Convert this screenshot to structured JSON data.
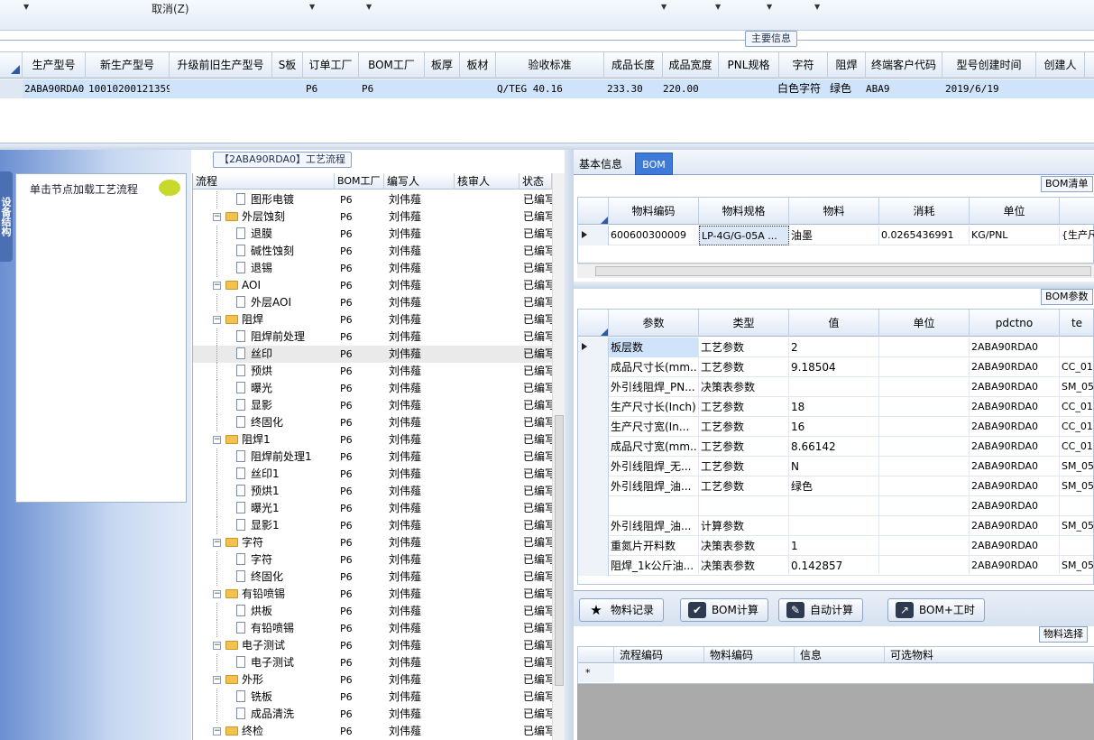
{
  "toolbar": {
    "cancel_label": "取消(Z)"
  },
  "main_info": {
    "section_label": "主要信息",
    "headers": [
      "生产型号",
      "新生产型号",
      "升级前旧生产型号",
      "S板",
      "订单工厂",
      "BOM工厂",
      "板厚",
      "板材",
      "验收标准",
      "成品长度",
      "成品宽度",
      "PNL规格",
      "字符",
      "阻焊",
      "终端客户代码",
      "型号创建时间",
      "创建人"
    ],
    "row": {
      "c0": "2ABA90RDA0",
      "c1": "10010200121359",
      "c2": "",
      "c3": "",
      "c4": "P6",
      "c5": "P6",
      "c6": "",
      "c7": "",
      "c8": "Q/TEG 40.16",
      "c9": "233.30",
      "c10": "220.00",
      "c11": "",
      "c12": "白色字符",
      "c13": "绿色",
      "c14": "ABA9",
      "c15": "2019/6/19",
      "c16": ""
    }
  },
  "left_panel": {
    "tab_label": "设备结构",
    "hint": "单击节点加载工艺流程"
  },
  "process_tree": {
    "title": "【2ABA90RDA0】工艺流程",
    "headers": {
      "flow": "流程",
      "bom": "BOM工厂",
      "author": "编写人",
      "reviewer": "核审人",
      "status": "状态"
    },
    "rows": [
      {
        "name": "图形电镀",
        "bom": "P6",
        "author": "刘伟薤",
        "status": "已编写"
      },
      {
        "name": "外层蚀刻",
        "bom": "P6",
        "author": "刘伟薤",
        "status": "已编写"
      },
      {
        "name": "退膜",
        "bom": "P6",
        "author": "刘伟薤",
        "status": "已编写"
      },
      {
        "name": "碱性蚀刻",
        "bom": "P6",
        "author": "刘伟薤",
        "status": "已编写"
      },
      {
        "name": "退锡",
        "bom": "P6",
        "author": "刘伟薤",
        "status": "已编写"
      },
      {
        "name": "AOI",
        "bom": "P6",
        "author": "刘伟薤",
        "status": "已编写"
      },
      {
        "name": "外层AOI",
        "bom": "P6",
        "author": "刘伟薤",
        "status": "已编写"
      },
      {
        "name": "阻焊",
        "bom": "P6",
        "author": "刘伟薤",
        "status": "已编写"
      },
      {
        "name": "阻焊前处理",
        "bom": "P6",
        "author": "刘伟薤",
        "status": "已编写"
      },
      {
        "name": "丝印",
        "bom": "P6",
        "author": "刘伟薤",
        "status": "已编写"
      },
      {
        "name": "预烘",
        "bom": "P6",
        "author": "刘伟薤",
        "status": "已编写"
      },
      {
        "name": "曝光",
        "bom": "P6",
        "author": "刘伟薤",
        "status": "已编写"
      },
      {
        "name": "显影",
        "bom": "P6",
        "author": "刘伟薤",
        "status": "已编写"
      },
      {
        "name": "终固化",
        "bom": "P6",
        "author": "刘伟薤",
        "status": "已编写"
      },
      {
        "name": "阻焊1",
        "bom": "P6",
        "author": "刘伟薤",
        "status": "已编写"
      },
      {
        "name": "阻焊前处理1",
        "bom": "P6",
        "author": "刘伟薤",
        "status": "已编写"
      },
      {
        "name": "丝印1",
        "bom": "P6",
        "author": "刘伟薤",
        "status": "已编写"
      },
      {
        "name": "预烘1",
        "bom": "P6",
        "author": "刘伟薤",
        "status": "已编写"
      },
      {
        "name": "曝光1",
        "bom": "P6",
        "author": "刘伟薤",
        "status": "已编写"
      },
      {
        "name": "显影1",
        "bom": "P6",
        "author": "刘伟薤",
        "status": "已编写"
      },
      {
        "name": "字符",
        "bom": "P6",
        "author": "刘伟薤",
        "status": "已编写"
      },
      {
        "name": "字符",
        "bom": "P6",
        "author": "刘伟薤",
        "status": "已编写"
      },
      {
        "name": "终固化",
        "bom": "P6",
        "author": "刘伟薤",
        "status": "已编写"
      },
      {
        "name": "有铅喷锡",
        "bom": "P6",
        "author": "刘伟薤",
        "status": "已编写"
      },
      {
        "name": "烘板",
        "bom": "P6",
        "author": "刘伟薤",
        "status": "已编写"
      },
      {
        "name": "有铅喷锡",
        "bom": "P6",
        "author": "刘伟薤",
        "status": "已编写"
      },
      {
        "name": "电子测试",
        "bom": "P6",
        "author": "刘伟薤",
        "status": "已编写"
      },
      {
        "name": "电子测试",
        "bom": "P6",
        "author": "刘伟薤",
        "status": "已编写"
      },
      {
        "name": "外形",
        "bom": "P6",
        "author": "刘伟薤",
        "status": "已编写"
      },
      {
        "name": "铣板",
        "bom": "P6",
        "author": "刘伟薤",
        "status": "已编写"
      },
      {
        "name": "成品清洗",
        "bom": "P6",
        "author": "刘伟薤",
        "status": "已编写"
      },
      {
        "name": "终检",
        "bom": "P6",
        "author": "刘伟薤",
        "status": "已编写"
      }
    ]
  },
  "right_panel": {
    "tabs": [
      "基本信息",
      "BOM"
    ],
    "bom_list": {
      "label": "BOM清单",
      "headers": [
        "物料编码",
        "物料规格",
        "物料",
        "消耗",
        "单位"
      ],
      "row": [
        "600600300009",
        "LP-4G/G-05A ...",
        "油墨",
        "0.0265436991",
        "KG/PNL",
        "{生产尺"
      ]
    },
    "bom_params": {
      "label": "BOM参数",
      "headers": [
        "参数",
        "类型",
        "值",
        "单位",
        "pdctno",
        "te"
      ],
      "rows": [
        [
          "板层数",
          "工艺参数",
          "2",
          "",
          "2ABA90RDA0",
          ""
        ],
        [
          "成品尺寸长(mm...",
          "工艺参数",
          "9.18504",
          "",
          "2ABA90RDA0",
          "CC_01"
        ],
        [
          "外引线阻焊_PN...",
          "决策表参数",
          "",
          "",
          "2ABA90RDA0",
          "SM_05"
        ],
        [
          "生产尺寸长(Inch)",
          "工艺参数",
          "18",
          "",
          "2ABA90RDA0",
          "CC_01"
        ],
        [
          "生产尺寸宽(In...",
          "工艺参数",
          "16",
          "",
          "2ABA90RDA0",
          "CC_01"
        ],
        [
          "成品尺寸宽(mm...",
          "工艺参数",
          "8.66142",
          "",
          "2ABA90RDA0",
          "CC_01"
        ],
        [
          "外引线阻焊_无...",
          "工艺参数",
          "N",
          "",
          "2ABA90RDA0",
          "SM_05"
        ],
        [
          "外引线阻焊_油...",
          "工艺参数",
          "绿色",
          "",
          "2ABA90RDA0",
          "SM_05"
        ],
        [
          "",
          "",
          "",
          "",
          "2ABA90RDA0",
          ""
        ],
        [
          "外引线阻焊_油...",
          "计算参数",
          "",
          "",
          "2ABA90RDA0",
          "SM_05"
        ],
        [
          "重氮片开料数",
          "决策表参数",
          "1",
          "",
          "2ABA90RDA0",
          ""
        ],
        [
          "阻焊_1k公斤油...",
          "决策表参数",
          "0.142857",
          "",
          "2ABA90RDA0",
          "SM_05"
        ]
      ]
    },
    "buttons": {
      "material_record": "物料记录",
      "bom_calc": "BOM计算",
      "auto_calc": "自动计算",
      "bom_hours": "BOM+工时"
    },
    "material_select": {
      "label": "物料选择",
      "headers": [
        "流程编码",
        "物料编码",
        "信息",
        "可选物料"
      ],
      "new_row_marker": "*"
    }
  },
  "colors": {
    "selected_row": "#cfe3fb",
    "tab_active": "#3e7bd8",
    "accent": "#2a5ba8"
  }
}
